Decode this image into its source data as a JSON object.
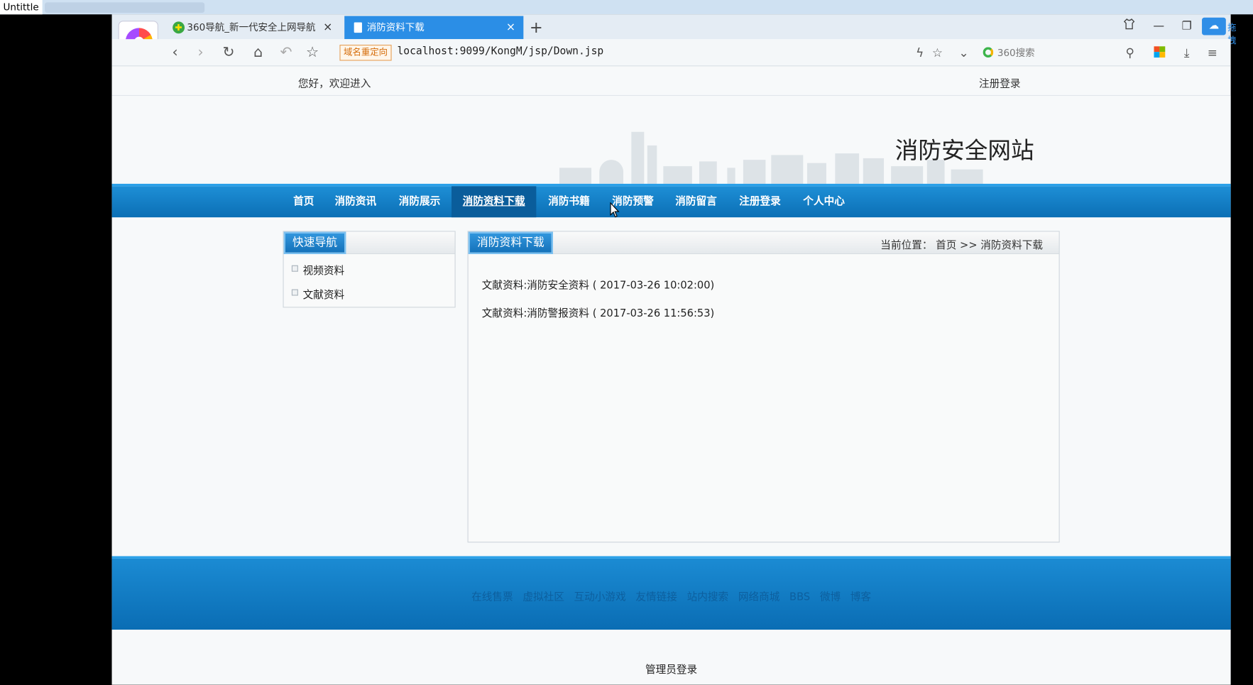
{
  "os": {
    "window_title": "Untittle"
  },
  "browser": {
    "tabs": [
      {
        "label": "360导航_新一代安全上网导航",
        "close": "×"
      },
      {
        "label": "消防资料下载",
        "close": "×"
      }
    ],
    "new_tab": "+",
    "redirect_badge": "域名重定向",
    "url": "localhost:9099/KongM/jsp/Down.jsp",
    "search_placeholder": "360搜索",
    "drag_label": "拖拽"
  },
  "page": {
    "greeting": "您好，欢迎进入",
    "register_login": "注册登录",
    "site_title": "消防安全网站",
    "main_nav": [
      "首页",
      "消防资讯",
      "消防展示",
      "消防资料下载",
      "消防书籍",
      "消防预警",
      "消防留言",
      "注册登录",
      "个人中心"
    ],
    "active_nav": "消防资料下载",
    "quick_nav": {
      "title": "快速导航",
      "links": [
        "视频资料",
        "文献资料"
      ]
    },
    "content": {
      "title": "消防资料下载",
      "breadcrumb": "当前位置： 首页 >>  消防资料下载",
      "entries": [
        "文献资料:消防安全资料 ( 2017-03-26 10:02:00)",
        "文献资料:消防警报资料 ( 2017-03-26 11:56:53)"
      ]
    },
    "footer_links": [
      "在线售票",
      "虚拟社区",
      "互动小游戏",
      "友情链接",
      "站内搜索",
      "网络商城",
      "BBS",
      "微博",
      "博客"
    ],
    "admin_login": "管理员登录"
  }
}
